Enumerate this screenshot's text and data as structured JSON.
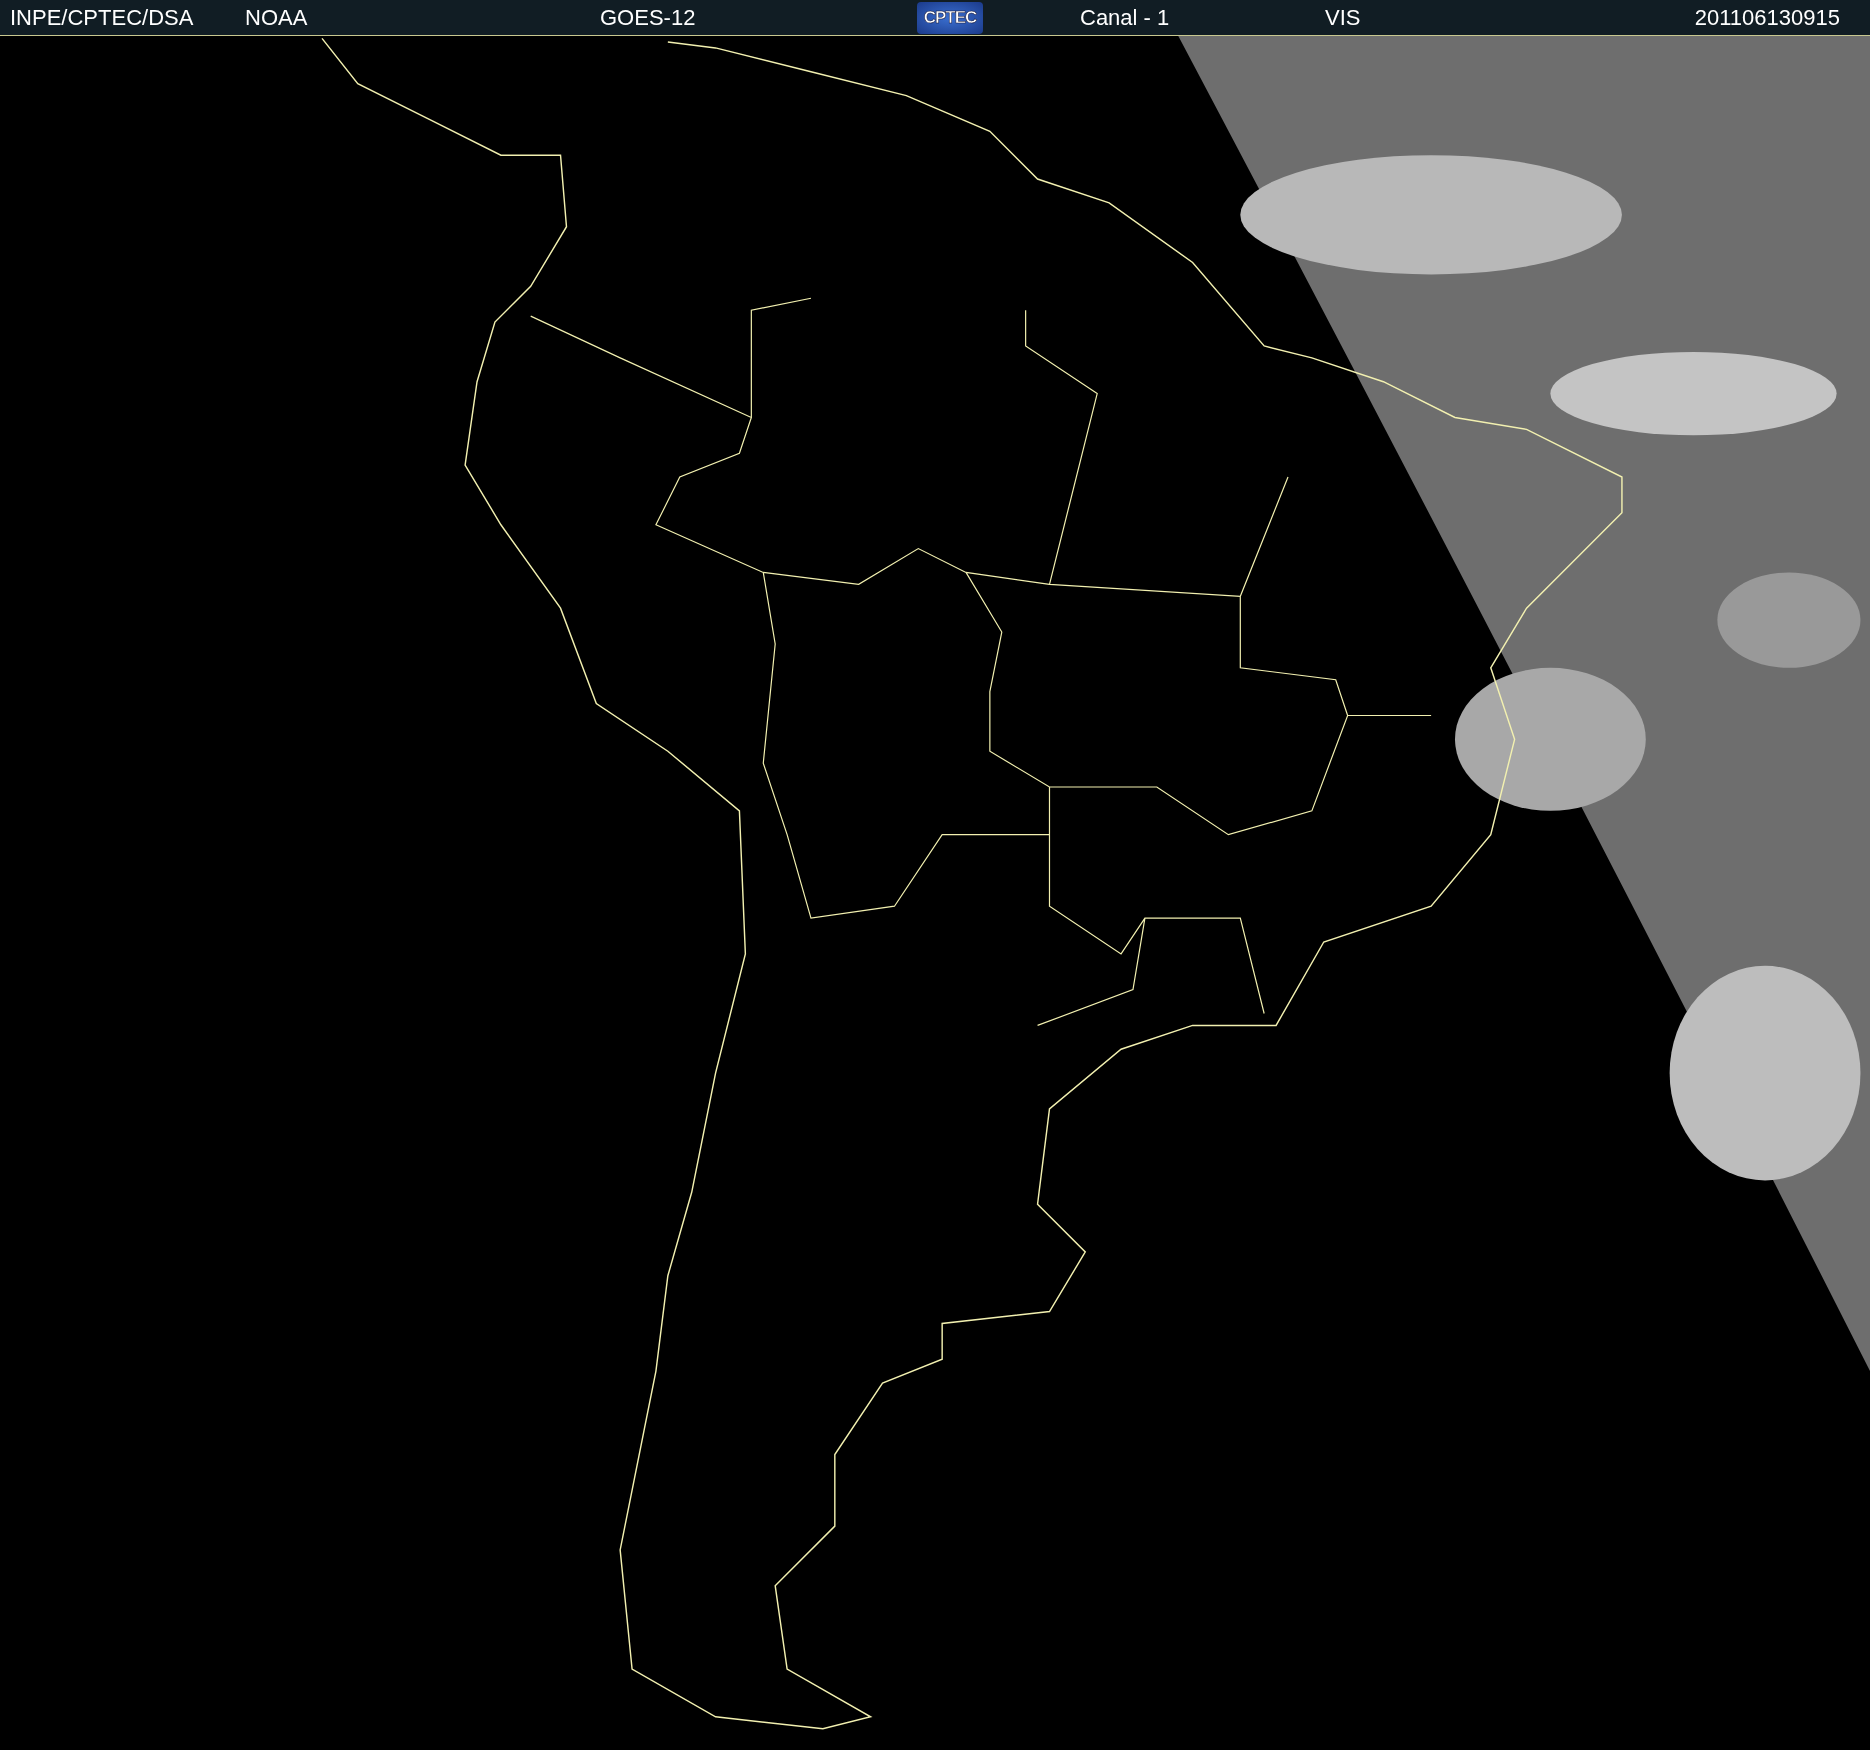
{
  "header": {
    "source": "INPE/CPTEC/DSA",
    "agency": "NOAA",
    "satellite": "GOES-12",
    "logo": "CPTEC",
    "channel": "Canal - 1",
    "band": "VIS",
    "timestamp": "201106130915"
  }
}
